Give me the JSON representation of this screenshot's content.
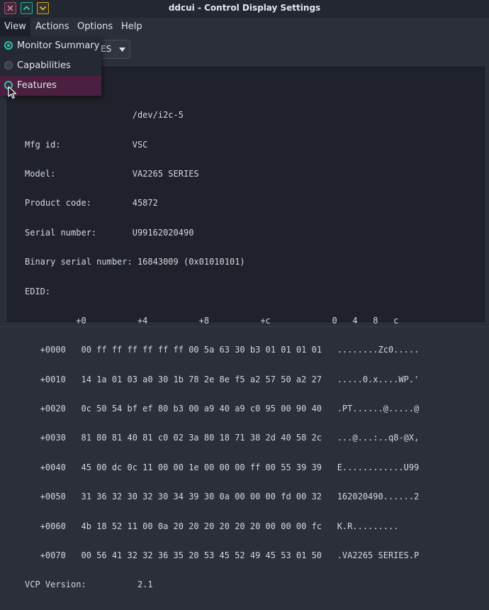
{
  "window": {
    "title": "ddcui - Control Display Settings"
  },
  "menubar": {
    "items": [
      {
        "label": "View"
      },
      {
        "label": "Actions"
      },
      {
        "label": "Options"
      },
      {
        "label": "Help"
      }
    ]
  },
  "view_menu": {
    "items": [
      {
        "label": "Monitor Summary",
        "state": "checked"
      },
      {
        "label": "Capabilities",
        "state": "unchecked"
      },
      {
        "label": "Features",
        "state": "hovered"
      }
    ]
  },
  "monitor_select": {
    "value_fragment": "ES"
  },
  "summary": {
    "lines": [
      "",
      "                     /dev/i2c-5",
      "Mfg id:              VSC",
      "Model:               VA2265 SERIES",
      "Product code:        45872",
      "Serial number:       U99162020490",
      "Binary serial number: 16843009 (0x01010101)",
      "EDID:"
    ],
    "edid_header": "          +0          +4          +8          +c            0   4   8   c",
    "edid_rows": [
      "   +0000   00 ff ff ff ff ff ff 00 5a 63 30 b3 01 01 01 01   ........Zc0.....",
      "   +0010   14 1a 01 03 a0 30 1b 78 2e 8e f5 a2 57 50 a2 27   .....0.x....WP.'",
      "   +0020   0c 50 54 bf ef 80 b3 00 a9 40 a9 c0 95 00 90 40   .PT......@.....@",
      "   +0030   81 80 81 40 81 c0 02 3a 80 18 71 38 2d 40 58 2c   ...@...:..q8-@X,",
      "   +0040   45 00 dc 0c 11 00 00 1e 00 00 00 ff 00 55 39 39   E............U99",
      "   +0050   31 36 32 30 32 30 34 39 30 0a 00 00 00 fd 00 32   162020490......2",
      "   +0060   4b 18 52 11 00 0a 20 20 20 20 20 20 00 00 00 fc   K.R.........    ",
      "   +0070   00 56 41 32 32 36 35 20 53 45 52 49 45 53 01 50   .VA2265 SERIES.P"
    ],
    "vcp_line": "VCP Version:          2.1"
  },
  "colors": {
    "accent": "#2fc4ae",
    "hover": "#4a1f3f",
    "panel": "#1f222a",
    "window": "#2b2f39"
  }
}
